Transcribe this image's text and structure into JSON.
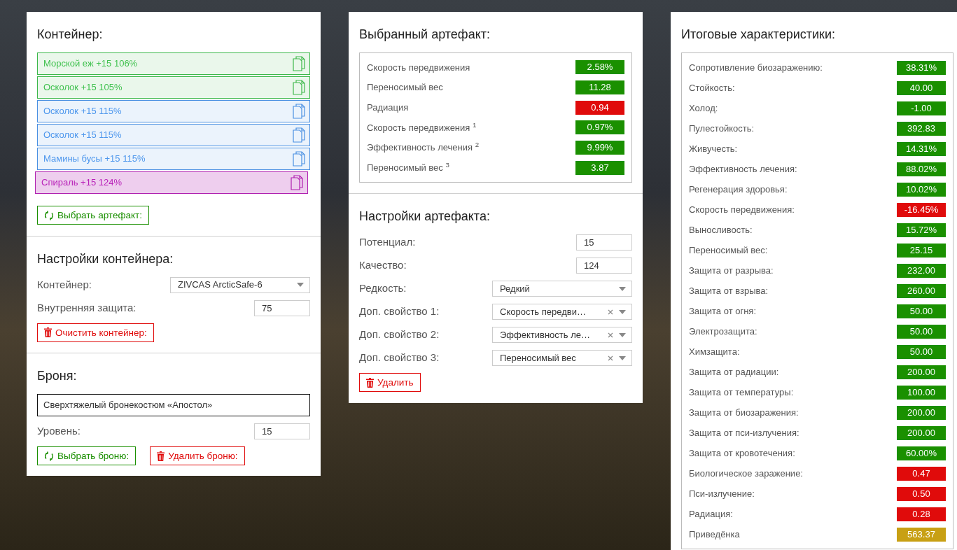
{
  "container_panel": {
    "title": "Контейнер:",
    "artifacts": [
      {
        "label": "Морской еж +15 106%",
        "color": "#3cb84a",
        "selected": false
      },
      {
        "label": "Осколок +15 105%",
        "color": "#3cb84a",
        "selected": false
      },
      {
        "label": "Осколок +15 115%",
        "color": "#4a90e2",
        "selected": false
      },
      {
        "label": "Осколок +15 115%",
        "color": "#4a90e2",
        "selected": false
      },
      {
        "label": "Мамины бусы +15 115%",
        "color": "#4a90e2",
        "selected": false
      },
      {
        "label": "Спираль +15 124%",
        "color": "#b01fb0",
        "selected": true
      }
    ],
    "pick_button": "Выбрать артефакт:"
  },
  "container_settings": {
    "title": "Настройки контейнера:",
    "fields": [
      {
        "kind": "select",
        "label": "Контейнер:",
        "value": "ZIVCAS ArcticSafe-6",
        "clearable": false
      },
      {
        "kind": "input",
        "label": "Внутренняя защита:",
        "value": "75"
      }
    ],
    "clear_button": "Очистить контейнер:"
  },
  "armor": {
    "title": "Броня:",
    "name": "Сверхтяжелый бронекостюм «Апостол»",
    "fields": [
      {
        "kind": "input",
        "label": "Уровень:",
        "value": "15"
      }
    ],
    "pick_button": "Выбрать броню:",
    "delete_button": "Удалить броню:"
  },
  "selected_artifact": {
    "title": "Выбранный артефакт:",
    "stats": [
      {
        "label": "Скорость передвижения",
        "value": "2.58%",
        "color": "#1a9000"
      },
      {
        "label": "Переносимый вес",
        "value": "11.28",
        "color": "#1a9000"
      },
      {
        "label": "Радиация",
        "value": "0.94",
        "color": "#e00b0b"
      },
      {
        "label": "Скорость передвижения $^{1}$",
        "value": "0.97%",
        "color": "#1a9000"
      },
      {
        "label": "Эффективность лечения $^{2}$",
        "value": "9.99%",
        "color": "#1a9000"
      },
      {
        "label": "Переносимый вес $^{3}$",
        "value": "3.87",
        "color": "#1a9000"
      }
    ]
  },
  "artifact_settings": {
    "title": "Настройки артефакта:",
    "fields": [
      {
        "kind": "input",
        "label": "Потенциал:",
        "value": "15"
      },
      {
        "kind": "input",
        "label": "Качество:",
        "value": "124"
      },
      {
        "kind": "select",
        "label": "Редкость:",
        "value": "Редкий",
        "clearable": false
      },
      {
        "kind": "select",
        "label": "Доп. свойство 1:",
        "value": "Скорость передви…",
        "clearable": true
      },
      {
        "kind": "select",
        "label": "Доп. свойство 2:",
        "value": "Эффективность ле…",
        "clearable": true
      },
      {
        "kind": "select",
        "label": "Доп. свойство 3:",
        "value": "Переносимый вес",
        "clearable": true
      }
    ],
    "delete_button": "Удалить"
  },
  "totals": {
    "title": "Итоговые характеристики:",
    "stats": [
      {
        "label": "Сопротивление биозаражению:",
        "value": "38.31%",
        "color": "#1a9000"
      },
      {
        "label": "Стойкость:",
        "value": "40.00",
        "color": "#1a9000"
      },
      {
        "label": "Холод:",
        "value": "-1.00",
        "color": "#1a9000"
      },
      {
        "label": "Пулестойкость:",
        "value": "392.83",
        "color": "#1a9000"
      },
      {
        "label": "Живучесть:",
        "value": "14.31%",
        "color": "#1a9000"
      },
      {
        "label": "Эффективность лечения:",
        "value": "88.02%",
        "color": "#1a9000"
      },
      {
        "label": "Регенерация здоровья:",
        "value": "10.02%",
        "color": "#1a9000"
      },
      {
        "label": "Скорость передвижения:",
        "value": "-16.45%",
        "color": "#e00b0b"
      },
      {
        "label": "Выносливость:",
        "value": "15.72%",
        "color": "#1a9000"
      },
      {
        "label": "Переносимый вес:",
        "value": "25.15",
        "color": "#1a9000"
      },
      {
        "label": "Защита от разрыва:",
        "value": "232.00",
        "color": "#1a9000"
      },
      {
        "label": "Защита от взрыва:",
        "value": "260.00",
        "color": "#1a9000"
      },
      {
        "label": "Защита от огня:",
        "value": "50.00",
        "color": "#1a9000"
      },
      {
        "label": "Электрозащита:",
        "value": "50.00",
        "color": "#1a9000"
      },
      {
        "label": "Химзащита:",
        "value": "50.00",
        "color": "#1a9000"
      },
      {
        "label": "Защита от радиации:",
        "value": "200.00",
        "color": "#1a9000"
      },
      {
        "label": "Защита от температуры:",
        "value": "100.00",
        "color": "#1a9000"
      },
      {
        "label": "Защита от биозаражения:",
        "value": "200.00",
        "color": "#1a9000"
      },
      {
        "label": "Защита от пси-излучения:",
        "value": "200.00",
        "color": "#1a9000"
      },
      {
        "label": "Защита от кровотечения:",
        "value": "60.00%",
        "color": "#1a9000"
      },
      {
        "label": "Биологическое заражение:",
        "value": "0.47",
        "color": "#e00b0b"
      },
      {
        "label": "Пси-излучение:",
        "value": "0.50",
        "color": "#e00b0b"
      },
      {
        "label": "Радиация:",
        "value": "0.28",
        "color": "#e00b0b"
      },
      {
        "label": "Приведёнка",
        "value": "563.37",
        "color": "#c8a014"
      }
    ]
  }
}
